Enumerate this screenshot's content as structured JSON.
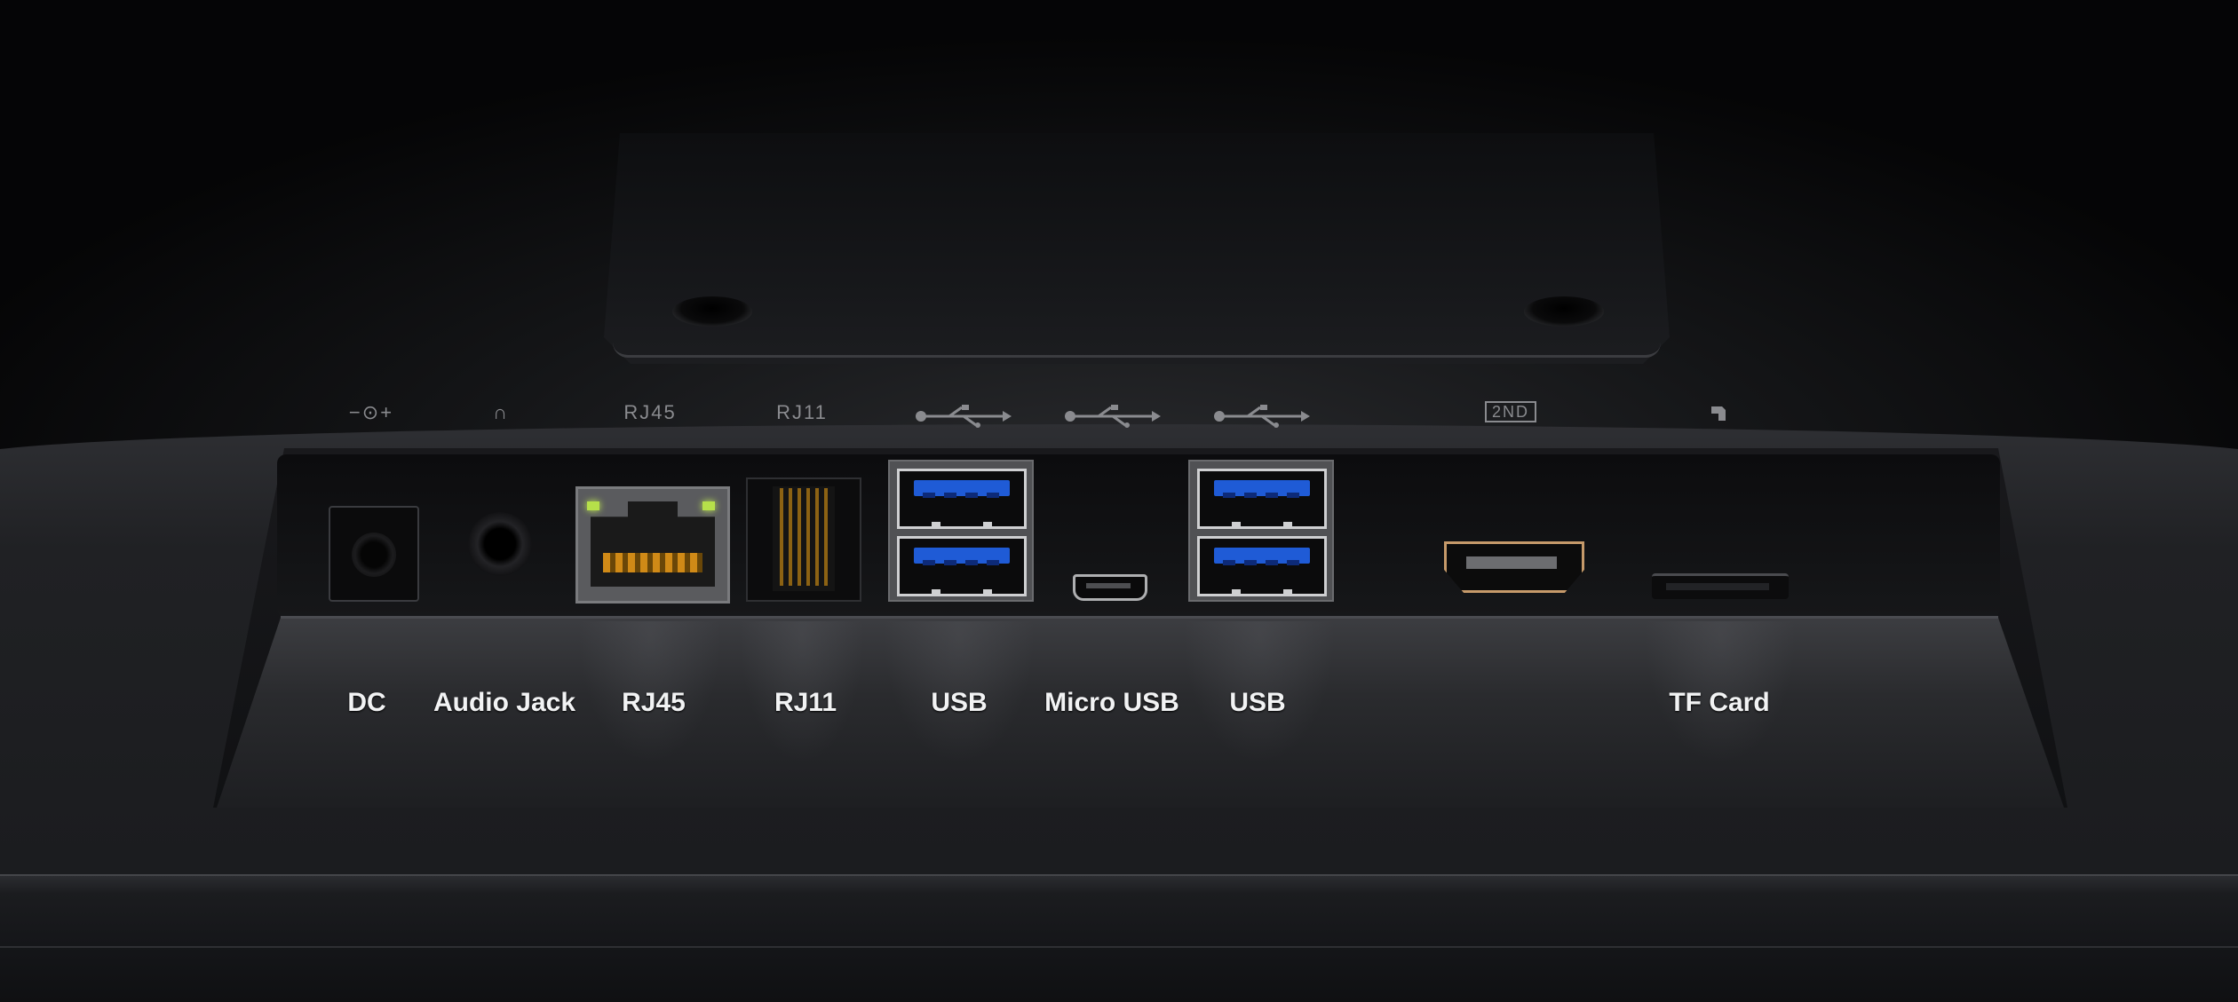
{
  "port_symbols": {
    "dc": "−⊙+",
    "audio": "∩",
    "rj45": "RJ45",
    "rj11": "RJ11",
    "hdmi": "2ND"
  },
  "port_labels": {
    "dc": "DC",
    "audio": "Audio Jack",
    "rj45": "RJ45",
    "rj11": "RJ11",
    "usb_left": "USB",
    "micro_usb": "Micro USB",
    "usb_right": "USB",
    "tf": "TF Card"
  },
  "colors": {
    "usb_tongue": "#1f5bd6",
    "rj45_led": "#b6e04a",
    "hdmi_trim": "#c69a6a",
    "label_text": "#f2f3f4"
  }
}
